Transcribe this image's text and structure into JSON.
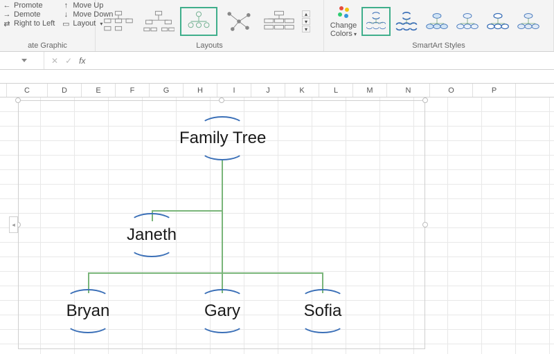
{
  "ribbon": {
    "group1": {
      "items_left": [
        {
          "icon": "arrow-up",
          "label": "Promote"
        },
        {
          "icon": "arrow-down",
          "label": "Demote"
        },
        {
          "icon": "rtl",
          "label": "Right to Left"
        }
      ],
      "items_right": [
        {
          "icon": "arrow-up",
          "label": "Move Up"
        },
        {
          "icon": "arrow-down",
          "label": "Move Down"
        },
        {
          "icon": "layout",
          "label": "Layout"
        }
      ],
      "label": "ate Graphic"
    },
    "group2": {
      "label": "Layouts",
      "selected": 2
    },
    "group3": {
      "label": "SmartArt Styles",
      "changecolors": "Change Colors",
      "selected": 0
    }
  },
  "formula_bar": {
    "cancel": "✕",
    "accept": "✓",
    "fx": "fx"
  },
  "columns": [
    "C",
    "D",
    "E",
    "F",
    "G",
    "H",
    "I",
    "J",
    "K",
    "L",
    "M",
    "N",
    "O",
    "P"
  ],
  "smartart": {
    "root": "Family Tree",
    "mid": "Janeth",
    "leaves": [
      "Bryan",
      "Gary",
      "Sofia"
    ]
  }
}
